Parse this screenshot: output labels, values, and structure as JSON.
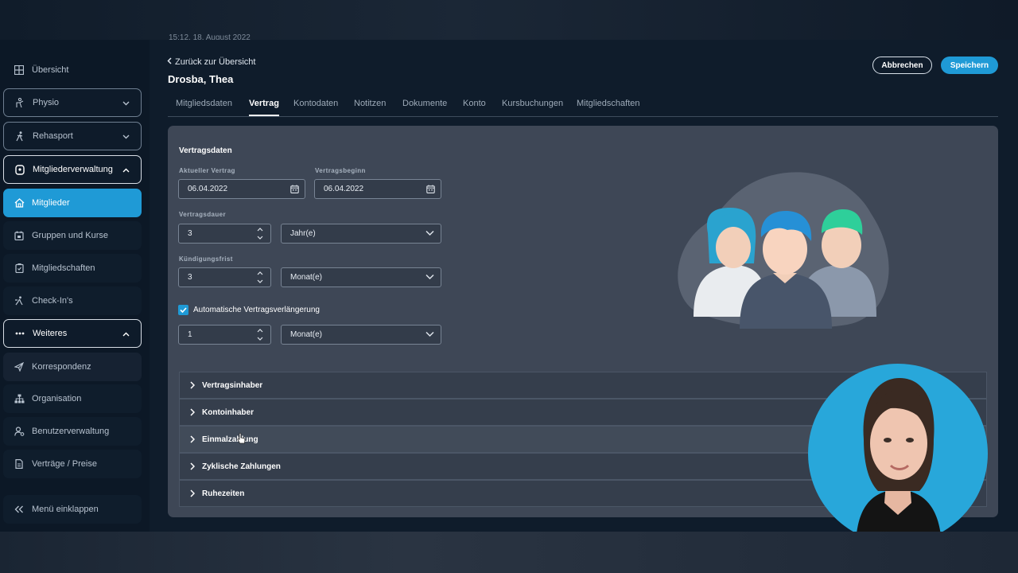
{
  "header": {
    "timestamp": "15:12, 18. August 2022",
    "back_label": "Zurück zur Übersicht",
    "person_name": "Drosba, Thea",
    "cancel_label": "Abbrechen",
    "save_label": "Speichern"
  },
  "sidebar": {
    "items": [
      {
        "label": "Übersicht",
        "icon": "grid-icon"
      },
      {
        "label": "Physio",
        "icon": "physio-icon"
      },
      {
        "label": "Rehasport",
        "icon": "walking-icon"
      },
      {
        "label": "Mitgliederverwaltung",
        "icon": "members-admin-icon"
      },
      {
        "label": "Mitglieder",
        "icon": "home-icon"
      },
      {
        "label": "Gruppen und Kurse",
        "icon": "calendar-icon"
      },
      {
        "label": "Mitgliedschaften",
        "icon": "membership-icon"
      },
      {
        "label": "Check-In's",
        "icon": "checkin-icon"
      },
      {
        "label": "Weiteres",
        "icon": "dots-icon"
      },
      {
        "label": "Korrespondenz",
        "icon": "send-icon"
      },
      {
        "label": "Organisation",
        "icon": "org-chart-icon"
      },
      {
        "label": "Benutzerverwaltung",
        "icon": "user-settings-icon"
      },
      {
        "label": "Verträge / Preise",
        "icon": "document-icon"
      },
      {
        "label": "Menü einklappen",
        "icon": "collapse-icon"
      }
    ]
  },
  "tabs": [
    "Mitgliedsdaten",
    "Vertrag",
    "Kontodaten",
    "Notitzen",
    "Dokumente",
    "Konto",
    "Kursbuchungen",
    "Mitgliedschaften"
  ],
  "active_tab": "Vertrag",
  "contract": {
    "section_title": "Vertragsdaten",
    "current_contract_label": "Aktueller Vertrag",
    "current_contract_value": "06.04.2022",
    "contract_start_label": "Vertragsbeginn",
    "contract_start_value": "06.04.2022",
    "duration_label": "Vertragsdauer",
    "duration_value": "3",
    "duration_unit": "Jahr(e)",
    "notice_label": "Kündigungsfrist",
    "notice_value": "3",
    "notice_unit": "Monat(e)",
    "auto_renew_label": "Automatische Vertragsverlängerung",
    "auto_renew_checked": true,
    "renew_value": "1",
    "renew_unit": "Monat(e)"
  },
  "accordion": [
    "Vertragsinhaber",
    "Kontoinhaber",
    "Einmalzahlung",
    "Zyklische Zahlungen",
    "Ruhezeiten"
  ],
  "colors": {
    "accent": "#1f9ad6",
    "background": "#0f1c2b",
    "panel": "#3e4756"
  }
}
